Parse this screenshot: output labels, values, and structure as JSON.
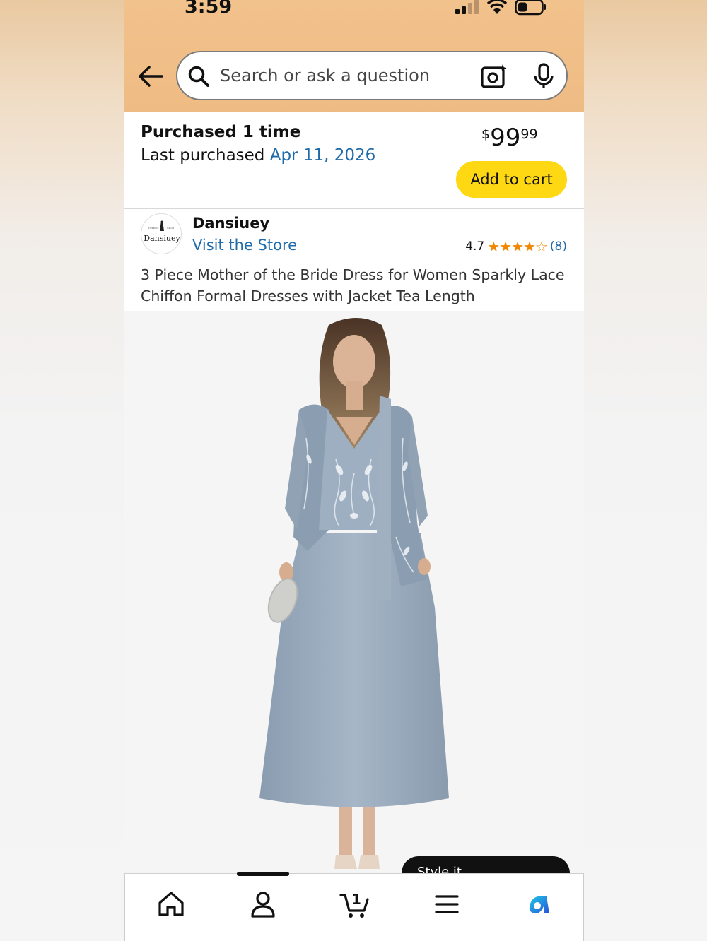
{
  "status_bar": {
    "time": "3:59"
  },
  "search": {
    "placeholder": "Search or ask a question"
  },
  "purchase": {
    "count_text": "Purchased 1 time",
    "last_label": "Last purchased ",
    "last_date": "Apr 11, 2026",
    "price_symbol": "$",
    "price_whole": "99",
    "price_fraction": "99",
    "add_to_cart_label": "Add to cart"
  },
  "store": {
    "logo_text": "Dansiuey",
    "name": "Dansiuey",
    "visit_label": "Visit the Store",
    "rating": "4.7",
    "stars": "★★★★☆",
    "stars_value": 4.7,
    "review_count": "(8)"
  },
  "product": {
    "title": "3 Piece Mother of the Bride Dress for Women Sparkly Lace Chiffon Formal Dresses with Jacket Tea Length",
    "style_pill_label": "Style it"
  },
  "nav": {
    "cart_count": "1",
    "items": [
      "home-icon",
      "account-icon",
      "cart-icon",
      "menu-icon",
      "rufus-icon"
    ]
  },
  "colors": {
    "header_bg": "#efbb84",
    "link_blue": "#1f6aa9",
    "add_to_cart_yellow": "#ffd814",
    "star_orange": "#f08804",
    "dress_blue_gray": "#98a9bc"
  }
}
